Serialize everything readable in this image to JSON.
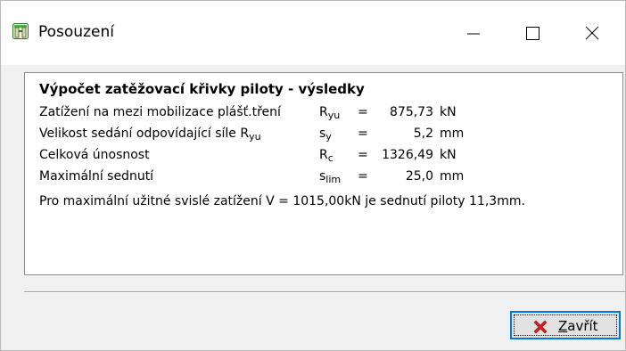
{
  "window": {
    "title": "Posouzení",
    "icon": "pile-app-icon",
    "controls": [
      "minimize-icon",
      "maximize-icon",
      "close-icon"
    ]
  },
  "results": {
    "heading": "Výpočet zatěžovací křivky piloty - výsledky",
    "rows": [
      {
        "label": "Zatížení na mezi mobilizace plášť.tření",
        "symbol": "R",
        "symbol_sub": "yu",
        "eq": "=",
        "value": "875,73",
        "unit": "kN"
      },
      {
        "label": "Velikost sedání odpovídající síle R",
        "label_sub": "yu",
        "symbol": "s",
        "symbol_sub": "y",
        "eq": "=",
        "value": "5,2",
        "unit": "mm"
      },
      {
        "label": "Celková únosnost",
        "symbol": "R",
        "symbol_sub": "c",
        "eq": "=",
        "value": "1326,49",
        "unit": "kN"
      },
      {
        "label": "Maximální sednutí",
        "symbol": "s",
        "symbol_sub": "lim",
        "eq": "=",
        "value": "25,0",
        "unit": "mm"
      }
    ],
    "summary": "Pro maximální užitné svislé zatížení V = 1015,00kN je sednutí piloty 11,3mm."
  },
  "buttons": {
    "close_accel": "Z",
    "close_rest": "avřít",
    "close_icon": "red-x-icon",
    "close_icon_color": "#d9201c"
  },
  "colors": {
    "titlebar": "#ffffff",
    "dialog_bg": "#f0f0f0",
    "button_focus": "#0078d7"
  }
}
